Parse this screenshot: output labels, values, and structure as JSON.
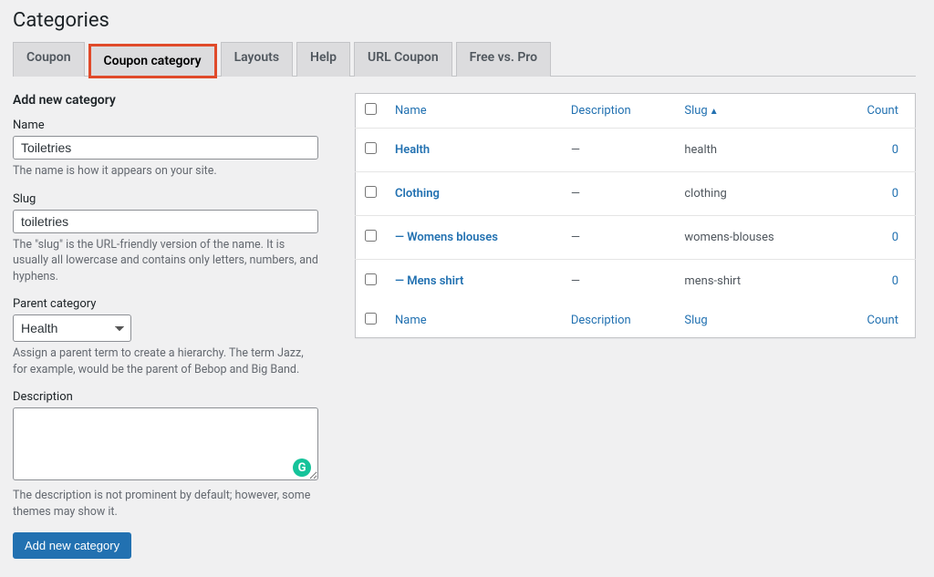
{
  "page_title": "Categories",
  "tabs": [
    {
      "label": "Coupon"
    },
    {
      "label": "Coupon category",
      "highlight": true
    },
    {
      "label": "Layouts"
    },
    {
      "label": "Help"
    },
    {
      "label": "URL Coupon"
    },
    {
      "label": "Free vs. Pro"
    }
  ],
  "form": {
    "heading": "Add new category",
    "name_label": "Name",
    "name_value": "Toiletries",
    "name_hint": "The name is how it appears on your site.",
    "slug_label": "Slug",
    "slug_value": "toiletries",
    "slug_hint": "The \"slug\" is the URL-friendly version of the name. It is usually all lowercase and contains only letters, numbers, and hyphens.",
    "parent_label": "Parent category",
    "parent_value": "Health",
    "parent_hint": "Assign a parent term to create a hierarchy. The term Jazz, for example, would be the parent of Bebop and Big Band.",
    "desc_label": "Description",
    "desc_value": "",
    "desc_hint": "The description is not prominent by default; however, some themes may show it.",
    "submit_label": "Add new category"
  },
  "table": {
    "cols": {
      "name": "Name",
      "description": "Description",
      "slug": "Slug",
      "count": "Count"
    },
    "sort_indicator": "▲",
    "rows": [
      {
        "name": "Health",
        "description": "—",
        "slug": "health",
        "count": "0"
      },
      {
        "name": "Clothing",
        "description": "—",
        "slug": "clothing",
        "count": "0"
      },
      {
        "name": "— Womens blouses",
        "description": "—",
        "slug": "womens-blouses",
        "count": "0"
      },
      {
        "name": "— Mens shirt",
        "description": "—",
        "slug": "mens-shirt",
        "count": "0"
      }
    ]
  }
}
